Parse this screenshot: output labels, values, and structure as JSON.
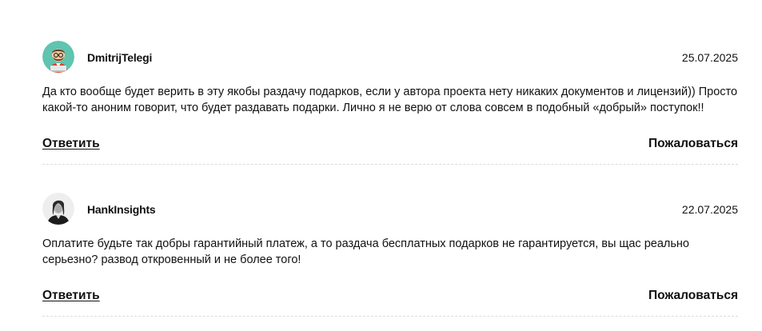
{
  "comments": [
    {
      "author": "DmitrijTelegi",
      "date": "25.07.2025",
      "text": "Да кто вообще будет верить в эту якобы раздачу подарков, если у автора проекта нету никаких документов и лицензий)) Просто какой-то аноним говорит, что будет раздавать подарки. Лично я не верю от слова совсем в подобный «добрый» поступок!!",
      "reply_label": "Ответить",
      "report_label": "Пожаловаться",
      "avatar": "cartoon-avatar-icon"
    },
    {
      "author": "HankInsights",
      "date": "22.07.2025",
      "text": "Оплатите будьте так добры гарантийный платеж, а то раздача бесплатных подарков не гарантируется, вы щас реально серьезно? развод откровенный и не более того!",
      "reply_label": "Ответить",
      "report_label": "Пожаловаться",
      "avatar": "photo-avatar-icon"
    }
  ],
  "colors": {
    "text": "#111111",
    "divider": "#dcdcdc",
    "avatar1_bg": "#5fc4b0"
  }
}
